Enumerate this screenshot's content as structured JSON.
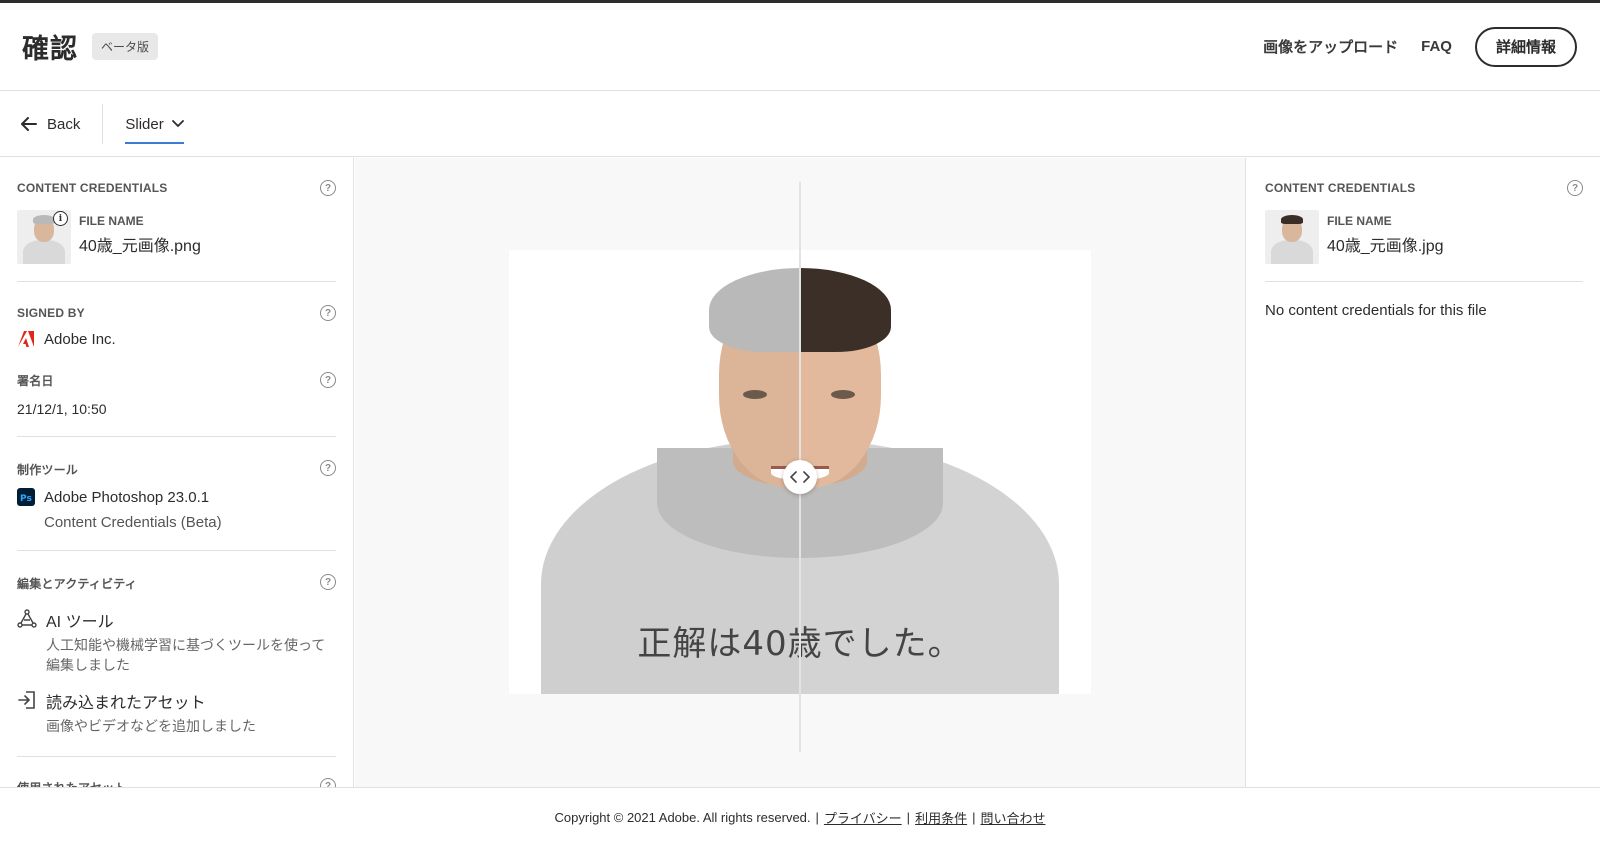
{
  "header": {
    "title": "確認",
    "badge": "ベータ版",
    "upload_link": "画像をアップロード",
    "faq_link": "FAQ",
    "details_button": "詳細情報"
  },
  "subbar": {
    "back_label": "Back",
    "mode_label": "Slider"
  },
  "left_panel": {
    "credentials_title": "CONTENT CREDENTIALS",
    "file_name_label": "FILE NAME",
    "file_name": "40歳_元画像.png",
    "signed_by_title": "SIGNED BY",
    "signed_by_value": "Adobe Inc.",
    "signed_date_title": "署名日",
    "signed_date_value": "21/12/1, 10:50",
    "tool_title": "制作ツール",
    "tool_name": "Adobe Photoshop 23.0.1",
    "tool_sub": "Content Credentials (Beta)",
    "activity_title": "編集とアクティビティ",
    "activities": [
      {
        "title": "AI ツール",
        "desc": "人工知能や機械学習に基づくツールを使って編集しました"
      },
      {
        "title": "読み込まれたアセット",
        "desc": "画像やビデオなどを追加しました"
      }
    ],
    "cut_title": "使用されたアセット"
  },
  "center": {
    "caption": "正解は40歳でした。",
    "slider_position": 0.5
  },
  "right_panel": {
    "credentials_title": "CONTENT CREDENTIALS",
    "file_name_label": "FILE NAME",
    "file_name": "40歳_元画像.jpg",
    "no_credentials": "No content credentials for this file"
  },
  "footer": {
    "copyright": "Copyright © 2021 Adobe. All rights reserved.",
    "privacy": "プライバシー",
    "terms": "利用条件",
    "contact": "問い合わせ",
    "separator": "|"
  },
  "colors": {
    "accent": "#3b7bd6",
    "adobe_red": "#e1251b",
    "ps_blue": "#001e36"
  },
  "icons": {
    "back": "arrow-left-icon",
    "mode": "chevron-down-icon",
    "help": "help-circle-icon",
    "info": "info-icon",
    "adobe": "adobe-logo-icon",
    "photoshop": "photoshop-app-icon",
    "ai": "ai-tool-icon",
    "import": "import-asset-icon",
    "slider": "slider-handle-icon"
  }
}
